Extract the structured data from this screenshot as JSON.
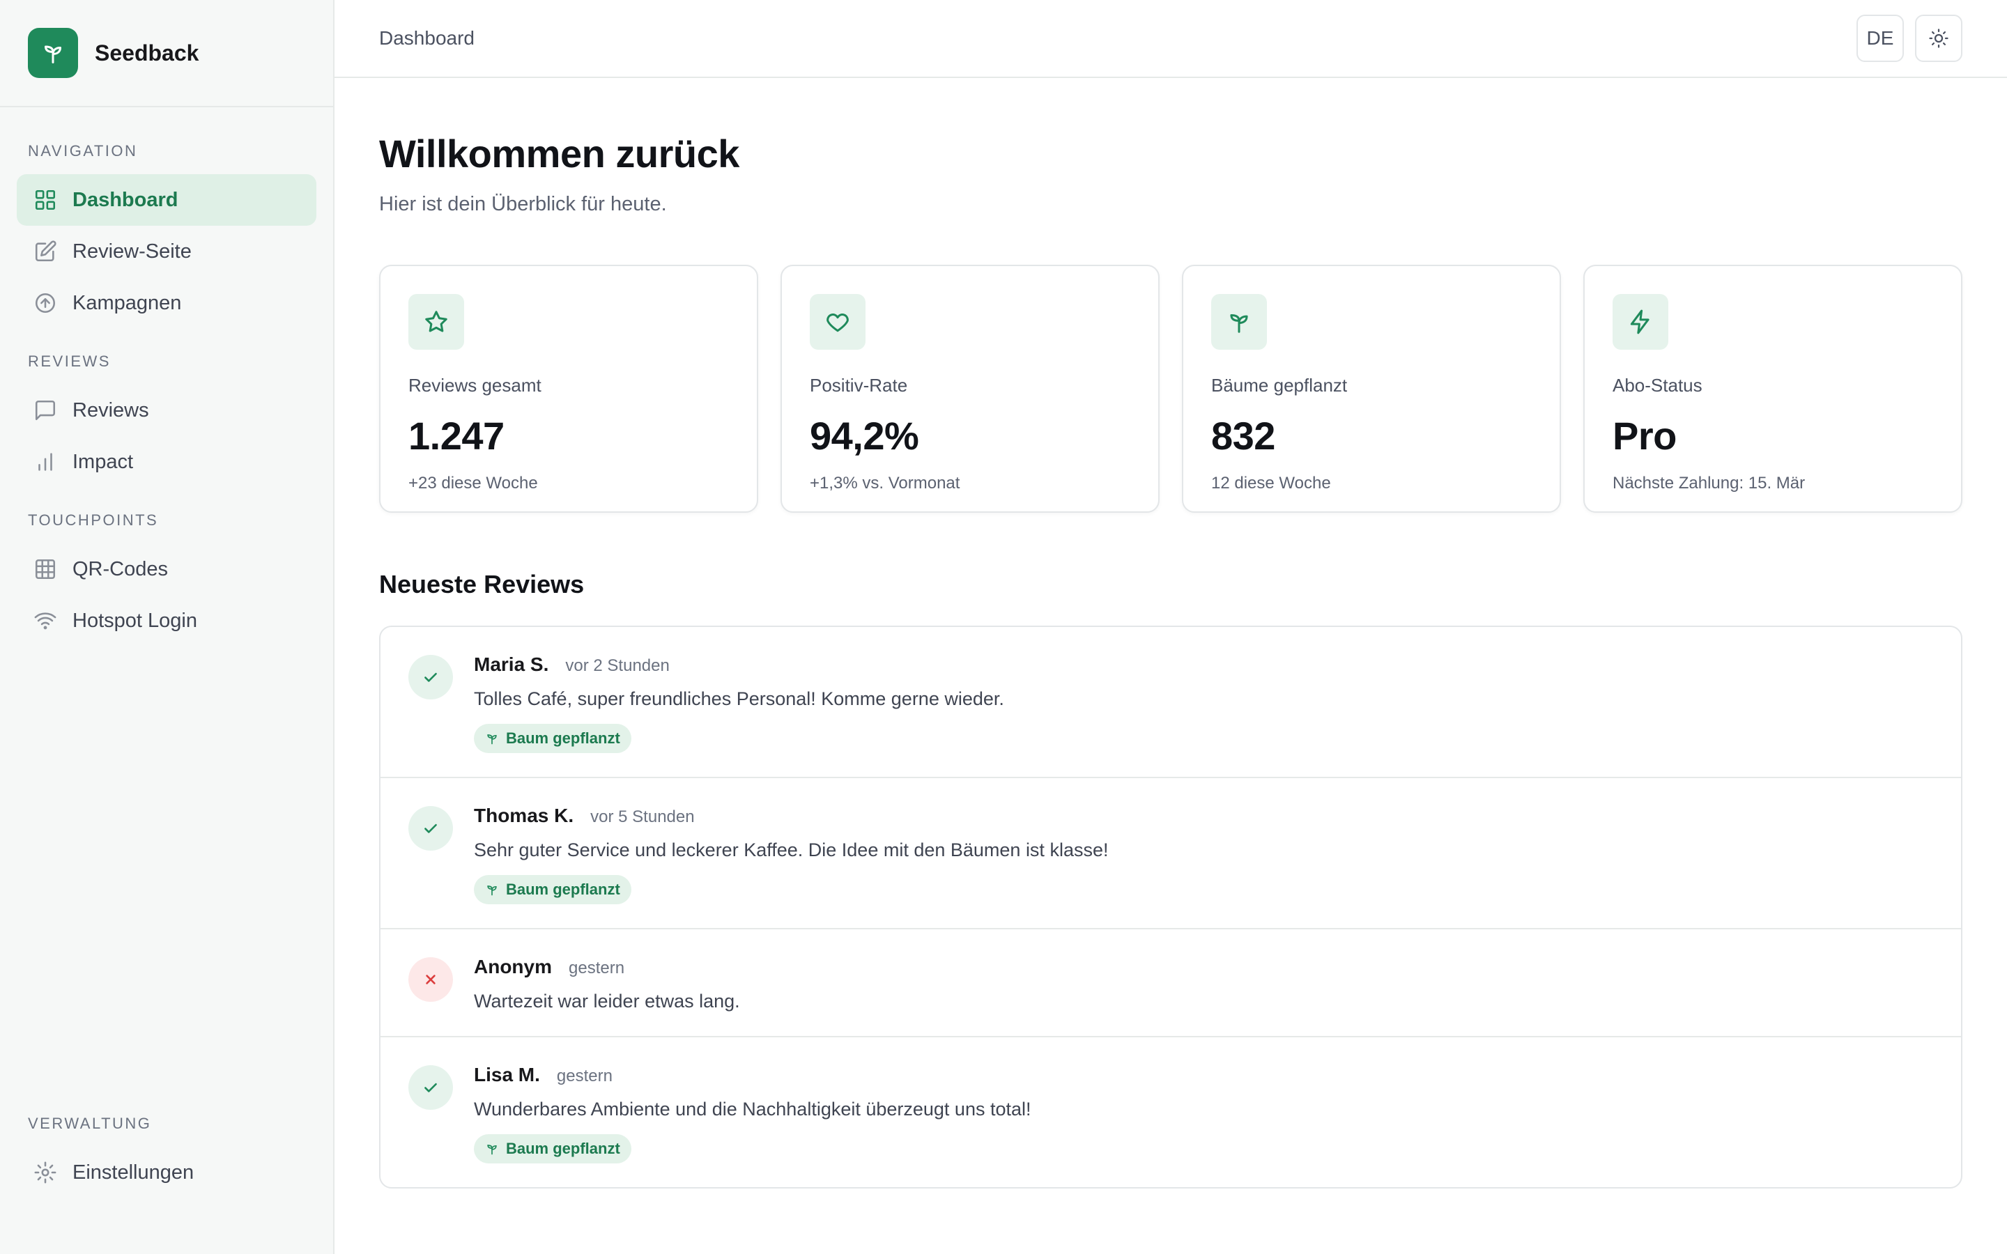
{
  "brand": {
    "name": "Seedback",
    "logo_icon": "sprout-icon",
    "accent": "#1f8a5b"
  },
  "sidebar": {
    "sections": [
      {
        "heading": "NAVIGATION",
        "items": [
          {
            "label": "Dashboard",
            "icon": "grid-icon",
            "active": true
          },
          {
            "label": "Review-Seite",
            "icon": "edit-icon",
            "active": false
          },
          {
            "label": "Kampagnen",
            "icon": "arrow-up-circle-icon",
            "active": false
          }
        ]
      },
      {
        "heading": "REVIEWS",
        "items": [
          {
            "label": "Reviews",
            "icon": "message-icon",
            "active": false
          },
          {
            "label": "Impact",
            "icon": "bar-chart-icon",
            "active": false
          }
        ]
      },
      {
        "heading": "TOUCHPOINTS",
        "items": [
          {
            "label": "QR-Codes",
            "icon": "qr-grid-icon",
            "active": false
          },
          {
            "label": "Hotspot Login",
            "icon": "wifi-icon",
            "active": false
          }
        ]
      }
    ],
    "bottom": {
      "heading": "VERWALTUNG",
      "items": [
        {
          "label": "Einstellungen",
          "icon": "gear-icon",
          "active": false
        }
      ]
    }
  },
  "header": {
    "title": "Dashboard",
    "language_label": "DE",
    "theme_icon": "sun-icon"
  },
  "main": {
    "title": "Willkommen zurück",
    "subtitle": "Hier ist dein Überblick für heute.",
    "stats": [
      {
        "icon": "star-icon",
        "label": "Reviews gesamt",
        "value": "1.247",
        "sub": "+23 diese Woche"
      },
      {
        "icon": "heart-icon",
        "label": "Positiv-Rate",
        "value": "94,2%",
        "sub": "+1,3% vs. Vormonat"
      },
      {
        "icon": "sprout-icon",
        "label": "Bäume gepflanzt",
        "value": "832",
        "sub": "12 diese Woche"
      },
      {
        "icon": "lightning-icon",
        "label": "Abo-Status",
        "value": "Pro",
        "sub": "Nächste Zahlung: 15. Mär"
      }
    ],
    "reviews_title": "Neueste Reviews",
    "reviews": [
      {
        "author": "Maria S.",
        "time": "vor 2 Stunden",
        "text": "Tolles Café, super freundliches Personal! Komme gerne wieder.",
        "positive": true,
        "badge": "Baum gepflanzt"
      },
      {
        "author": "Thomas K.",
        "time": "vor 5 Stunden",
        "text": "Sehr guter Service und leckerer Kaffee. Die Idee mit den Bäumen ist klasse!",
        "positive": true,
        "badge": "Baum gepflanzt"
      },
      {
        "author": "Anonym",
        "time": "gestern",
        "text": "Wartezeit war leider etwas lang.",
        "positive": false,
        "badge": null
      },
      {
        "author": "Lisa M.",
        "time": "gestern",
        "text": "Wunderbares Ambiente und die Nachhaltigkeit überzeugt uns total!",
        "positive": true,
        "badge": "Baum gepflanzt"
      }
    ]
  }
}
